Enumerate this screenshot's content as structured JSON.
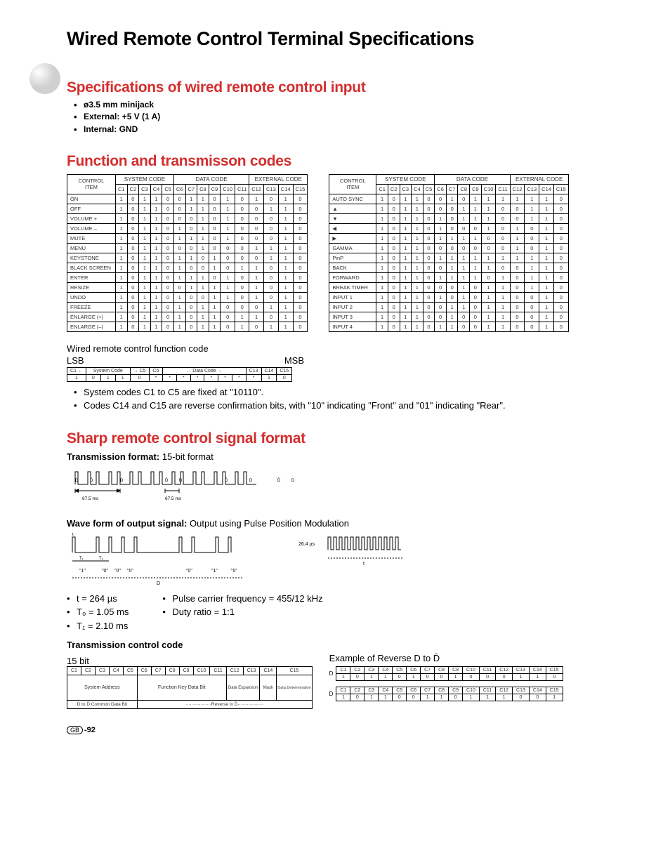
{
  "page": {
    "title": "Wired Remote Control Terminal Specifications",
    "page_number": "-92",
    "page_prefix": "GB"
  },
  "specs": {
    "heading": "Specifications of wired remote control input",
    "items": [
      "ø3.5 mm minijack",
      "External: +5 V (1 A)",
      "Internal: GND"
    ]
  },
  "codes": {
    "heading": "Function and transmisson codes",
    "header_control": "CONTROL",
    "header_item": "ITEM",
    "group_system": "SYSTEM CODE",
    "group_data": "DATA CODE",
    "group_ext": "EXTERNAL CODE",
    "cols": [
      "C1",
      "C2",
      "C3",
      "C4",
      "C5",
      "C6",
      "C7",
      "C8",
      "C9",
      "C10",
      "C11",
      "C12",
      "C13",
      "C14",
      "C15"
    ],
    "left": [
      {
        "name": "ON",
        "v": [
          "1",
          "0",
          "1",
          "1",
          "0",
          "0",
          "1",
          "1",
          "0",
          "1",
          "0",
          "1",
          "0",
          "1",
          "0"
        ]
      },
      {
        "name": "OFF",
        "v": [
          "1",
          "0",
          "1",
          "1",
          "0",
          "0",
          "1",
          "1",
          "0",
          "1",
          "0",
          "0",
          "1",
          "1",
          "0"
        ]
      },
      {
        "name": "VOLUME +",
        "v": [
          "1",
          "0",
          "1",
          "1",
          "0",
          "0",
          "0",
          "1",
          "0",
          "1",
          "0",
          "0",
          "0",
          "1",
          "0"
        ]
      },
      {
        "name": "VOLUME –",
        "v": [
          "1",
          "0",
          "1",
          "1",
          "0",
          "1",
          "0",
          "1",
          "0",
          "1",
          "0",
          "0",
          "0",
          "1",
          "0"
        ]
      },
      {
        "name": "MUTE",
        "v": [
          "1",
          "0",
          "1",
          "1",
          "0",
          "1",
          "1",
          "1",
          "0",
          "1",
          "0",
          "0",
          "0",
          "1",
          "0"
        ]
      },
      {
        "name": "MENU",
        "v": [
          "1",
          "0",
          "1",
          "1",
          "0",
          "0",
          "0",
          "1",
          "0",
          "0",
          "0",
          "1",
          "1",
          "1",
          "0"
        ]
      },
      {
        "name": "KEYSTONE",
        "v": [
          "1",
          "0",
          "1",
          "1",
          "0",
          "1",
          "1",
          "0",
          "1",
          "0",
          "0",
          "0",
          "1",
          "1",
          "0"
        ]
      },
      {
        "name": "BLACK SCREEN",
        "v": [
          "1",
          "0",
          "1",
          "1",
          "0",
          "1",
          "0",
          "0",
          "1",
          "0",
          "1",
          "1",
          "0",
          "1",
          "0"
        ]
      },
      {
        "name": "ENTER",
        "v": [
          "1",
          "0",
          "1",
          "1",
          "0",
          "1",
          "1",
          "1",
          "0",
          "1",
          "0",
          "1",
          "0",
          "1",
          "0"
        ]
      },
      {
        "name": "RESIZE",
        "v": [
          "1",
          "0",
          "1",
          "1",
          "0",
          "0",
          "1",
          "1",
          "1",
          "1",
          "0",
          "1",
          "0",
          "1",
          "0"
        ]
      },
      {
        "name": "UNDO",
        "v": [
          "1",
          "0",
          "1",
          "1",
          "0",
          "1",
          "0",
          "0",
          "1",
          "1",
          "0",
          "1",
          "0",
          "1",
          "0"
        ]
      },
      {
        "name": "FREEZE",
        "v": [
          "1",
          "0",
          "1",
          "1",
          "0",
          "1",
          "0",
          "1",
          "1",
          "0",
          "0",
          "0",
          "1",
          "1",
          "0"
        ]
      },
      {
        "name": "ENLARGE (+)",
        "v": [
          "1",
          "0",
          "1",
          "1",
          "0",
          "1",
          "0",
          "1",
          "1",
          "0",
          "1",
          "1",
          "0",
          "1",
          "0"
        ]
      },
      {
        "name": "ENLARGE (–)",
        "v": [
          "1",
          "0",
          "1",
          "1",
          "0",
          "1",
          "0",
          "1",
          "1",
          "0",
          "1",
          "0",
          "1",
          "1",
          "0"
        ]
      }
    ],
    "right": [
      {
        "name": "AUTO SYNC",
        "v": [
          "1",
          "0",
          "1",
          "1",
          "0",
          "0",
          "1",
          "0",
          "1",
          "1",
          "1",
          "1",
          "1",
          "1",
          "0"
        ]
      },
      {
        "name": "▲",
        "v": [
          "1",
          "0",
          "1",
          "1",
          "0",
          "0",
          "0",
          "1",
          "1",
          "1",
          "0",
          "0",
          "1",
          "1",
          "0"
        ]
      },
      {
        "name": "▼",
        "v": [
          "1",
          "0",
          "1",
          "1",
          "0",
          "1",
          "0",
          "1",
          "1",
          "1",
          "0",
          "0",
          "1",
          "1",
          "0"
        ]
      },
      {
        "name": "◀",
        "v": [
          "1",
          "0",
          "1",
          "1",
          "0",
          "1",
          "0",
          "0",
          "0",
          "1",
          "0",
          "1",
          "0",
          "1",
          "0"
        ]
      },
      {
        "name": "▶",
        "v": [
          "1",
          "0",
          "1",
          "1",
          "0",
          "1",
          "1",
          "1",
          "1",
          "0",
          "0",
          "1",
          "0",
          "1",
          "0"
        ]
      },
      {
        "name": "GAMMA",
        "v": [
          "1",
          "0",
          "1",
          "1",
          "0",
          "0",
          "0",
          "0",
          "0",
          "0",
          "0",
          "1",
          "0",
          "1",
          "0"
        ]
      },
      {
        "name": "PinP",
        "v": [
          "1",
          "0",
          "1",
          "1",
          "0",
          "1",
          "1",
          "1",
          "1",
          "1",
          "1",
          "1",
          "1",
          "1",
          "0"
        ]
      },
      {
        "name": "BACK",
        "v": [
          "1",
          "0",
          "1",
          "1",
          "0",
          "0",
          "1",
          "1",
          "1",
          "1",
          "0",
          "0",
          "1",
          "1",
          "0"
        ]
      },
      {
        "name": "FORWARD",
        "v": [
          "1",
          "0",
          "1",
          "1",
          "0",
          "1",
          "1",
          "1",
          "1",
          "0",
          "1",
          "0",
          "1",
          "1",
          "0"
        ]
      },
      {
        "name": "BREAK TIMER",
        "v": [
          "1",
          "0",
          "1",
          "1",
          "0",
          "0",
          "0",
          "1",
          "0",
          "1",
          "1",
          "0",
          "1",
          "1",
          "0"
        ]
      },
      {
        "name": "INPUT 1",
        "v": [
          "1",
          "0",
          "1",
          "1",
          "0",
          "1",
          "0",
          "1",
          "0",
          "1",
          "1",
          "0",
          "0",
          "1",
          "0"
        ]
      },
      {
        "name": "INPUT 2",
        "v": [
          "1",
          "0",
          "1",
          "1",
          "0",
          "0",
          "1",
          "1",
          "0",
          "1",
          "1",
          "0",
          "0",
          "1",
          "0"
        ]
      },
      {
        "name": "INPUT 3",
        "v": [
          "1",
          "0",
          "1",
          "1",
          "0",
          "0",
          "1",
          "0",
          "0",
          "1",
          "1",
          "0",
          "0",
          "1",
          "0"
        ]
      },
      {
        "name": "INPUT 4",
        "v": [
          "1",
          "0",
          "1",
          "1",
          "0",
          "1",
          "1",
          "0",
          "0",
          "1",
          "1",
          "0",
          "0",
          "1",
          "0"
        ]
      }
    ],
    "func_code_label": "Wired remote control function code",
    "lsb": "LSB",
    "msb": "MSB",
    "mini_header_sys": "System Code",
    "mini_header_data": "Data Code",
    "mini_cols": [
      "C1",
      "",
      "",
      "",
      "C5",
      "C6",
      "",
      "",
      "",
      "",
      "",
      "",
      "C13",
      "C14",
      "C15"
    ],
    "mini_vals": [
      "1",
      "0",
      "1",
      "1",
      "0",
      "*",
      "*",
      "*",
      "*",
      "*",
      "*",
      "*",
      "*",
      "1",
      "0"
    ],
    "notes": [
      "System codes C1 to C5 are fixed at \"10110\".",
      "Codes C14 and C15 are reverse confirmation bits, with \"10\" indicating \"Front\" and \"01\" indicating \"Rear\"."
    ]
  },
  "signal": {
    "heading": "Sharp remote control signal  format",
    "trans_fmt_label": "Transmission format:",
    "trans_fmt_value": "15-bit format",
    "timing_a": "67.5 ms",
    "timing_b": "67.5 ms",
    "wave_label": "Wave form of output signal:",
    "wave_value": "Output using Pulse Position Modulation",
    "wave_sub": [
      "\"1\"",
      "\"0\"",
      "\"0\"",
      "\"0\"",
      "\"0\"",
      "\"1\"",
      "\"0\""
    ],
    "wave_d": "D",
    "wave_t0": "T₀",
    "wave_t1": "T₁",
    "wave_t": "t",
    "burst_time": "26.4 µs",
    "burst_t": "t",
    "params_left": [
      "t = 264 µs",
      "T₀ = 1.05 ms",
      "T₁ = 2.10 ms"
    ],
    "params_right": [
      "Pulse carrier frequency = 455/12 kHz",
      "Duty ratio = 1:1"
    ],
    "tcc_label": "Transmission control code",
    "fifteen_bit": "15 bit",
    "tcc_cols": [
      "C1",
      "C2",
      "C3",
      "C4",
      "C5",
      "C6",
      "C7",
      "C8",
      "C9",
      "C10",
      "C11",
      "C12",
      "C13",
      "C14",
      "C15"
    ],
    "tcc_sys": "System Address",
    "tcc_fn": "Function Key Data Bit",
    "tcc_de": "Data Expansion",
    "tcc_mask": "Mask",
    "tcc_dd": "Data Determination",
    "tcc_foot_l": "D to D̄ Common Data Bit",
    "tcc_foot_r": "Reverse in D̄",
    "example_label": "Example of Reverse D to D̄",
    "rev_d": "D",
    "rev_dbar": "D̄",
    "rev_cols": [
      "C1",
      "C2",
      "C3",
      "C4",
      "C5",
      "C6",
      "C7",
      "C8",
      "C9",
      "C10",
      "C11",
      "C12",
      "C13",
      "C14",
      "C15"
    ],
    "rev_d_vals": [
      "1",
      "0",
      "1",
      "1",
      "0",
      "1",
      "0",
      "0",
      "1",
      "0",
      "0",
      "0",
      "1",
      "1",
      "0"
    ],
    "rev_dbar_vals": [
      "1",
      "0",
      "1",
      "1",
      "0",
      "0",
      "1",
      "1",
      "0",
      "1",
      "1",
      "1",
      "0",
      "0",
      "1"
    ]
  }
}
